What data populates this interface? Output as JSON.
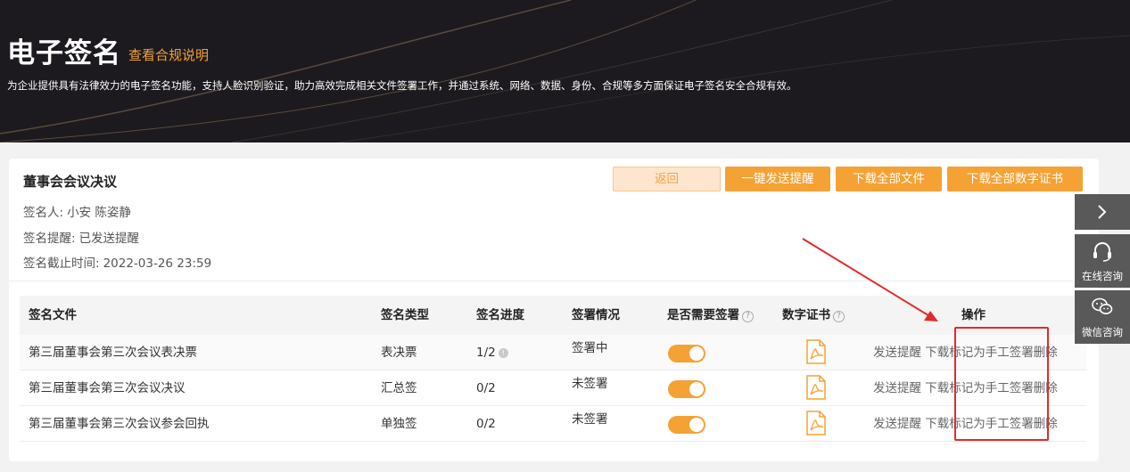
{
  "header": {
    "title": "电子签名",
    "compliance_link": "查看合规说明",
    "description": "为企业提供具有法律效力的电子签名功能，支持人脸识别验证，助力高效完成相关文件签署工作，并通过系统、网络、数据、身份、合规等多方面保证电子签名安全合规有效。"
  },
  "document": {
    "title": "董事会会议决议",
    "signers_label": "签名人:",
    "signers_value": "小安 陈姿静",
    "reminder_label": "签名提醒:",
    "reminder_value": "已发送提醒",
    "deadline_label": "签名截止时间:",
    "deadline_value": "2022-03-26 23:59"
  },
  "buttons": {
    "back": "返回",
    "send_reminder": "一键发送提醒",
    "download_all_files": "下载全部文件",
    "download_all_certs": "下载全部数字证书"
  },
  "table": {
    "headers": {
      "file": "签名文件",
      "type": "签名类型",
      "progress": "签名进度",
      "status": "签署情况",
      "need_sign": "是否需要签署",
      "cert": "数字证书",
      "actions": "操作"
    },
    "rows": [
      {
        "file": "第三届董事会第三次会议表决票",
        "type": "表决票",
        "progress": "1/2",
        "status": "签署中",
        "need_sign": true
      },
      {
        "file": "第三届董事会第三次会议决议",
        "type": "汇总签",
        "progress": "0/2",
        "status": "未签署",
        "need_sign": true
      },
      {
        "file": "第三届董事会第三次会议参会回执",
        "type": "单独签",
        "progress": "0/2",
        "status": "未签署",
        "need_sign": true
      }
    ],
    "action_labels": {
      "remind": "发送提醒",
      "download": "下载",
      "mark_manual": "标记为手工签署",
      "delete": "删除"
    }
  },
  "float_bar": {
    "online_consult": "在线咨询",
    "wechat_consult": "微信咨询"
  },
  "colors": {
    "accent": "#f5a234",
    "banner_bg": "#1c1a1f",
    "annotation": "#e02b2b"
  }
}
